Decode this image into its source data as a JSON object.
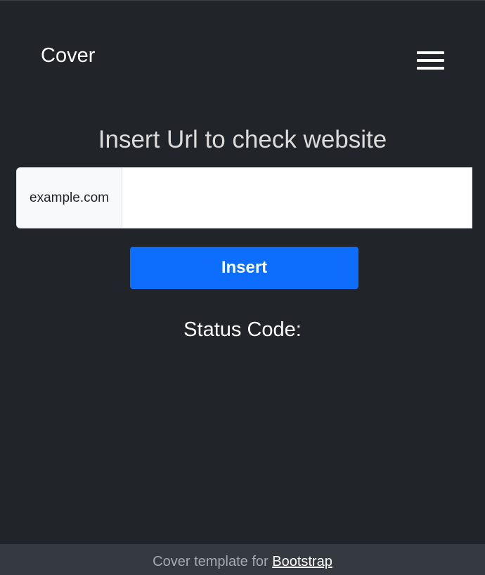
{
  "header": {
    "brand": "Cover",
    "menu_icon": "hamburger-menu-icon"
  },
  "main": {
    "heading": "Insert Url to check website",
    "url_addon": "example.com",
    "url_value": "",
    "url_placeholder": "",
    "insert_label": "Insert",
    "status_label": "Status Code:"
  },
  "footer": {
    "text": "Cover template for ",
    "link_text": "Bootstrap"
  },
  "colors": {
    "background": "#212529",
    "primary": "#0d6efd",
    "footer_bg": "#343a40"
  }
}
